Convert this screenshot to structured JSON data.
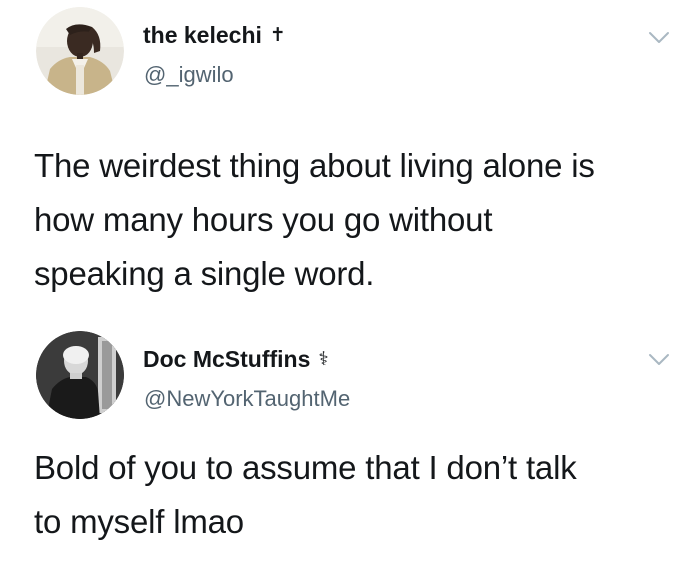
{
  "tweets": [
    {
      "display_name": "the kelechi",
      "name_emoji": "✝",
      "handle": "@_igwilo",
      "text_lines": [
        "The weirdest thing about living alone is",
        "how many hours you go without",
        "speaking a single word."
      ],
      "avatar_icon": "profile-photo",
      "menu_icon": "chevron-down-icon"
    },
    {
      "display_name": "Doc McStuffins",
      "name_emoji": "⚕",
      "handle": "@NewYorkTaughtMe",
      "text_lines": [
        "Bold of you to assume that I don’t talk",
        "to myself lmao"
      ],
      "avatar_icon": "profile-photo",
      "menu_icon": "chevron-down-icon"
    }
  ],
  "colors": {
    "text": "#14171a",
    "secondary_text": "#536471",
    "chevron": "#aab8c2",
    "background": "#ffffff"
  }
}
